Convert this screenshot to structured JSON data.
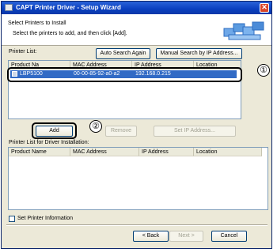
{
  "window": {
    "title": "CAPT Printer Driver - Setup Wizard",
    "close_glyph": "✕"
  },
  "header": {
    "heading": "Select Printers to Install",
    "subheading": "Select the printers to add, and then click [Add]."
  },
  "printer_list": {
    "label": "Printer List:",
    "auto_search_label": "Auto Search Again",
    "manual_search_label": "Manual Search by IP Address...",
    "columns": [
      "Product Na",
      "MAC Address",
      "IP Address",
      "Location"
    ],
    "rows": [
      {
        "product": "LBP5100",
        "mac": "00-00-85-92-a0-a2",
        "ip": "192.168.0.215"
      }
    ]
  },
  "actions": {
    "add_label": "Add",
    "remove_label": "Remove",
    "set_ip_label": "Set IP Address..."
  },
  "install_list": {
    "label": "Printer List for Driver Installation:",
    "columns": [
      "Product Name",
      "MAC Address",
      "IP Address",
      "Location"
    ]
  },
  "set_printer_info": {
    "label": "Set Printer Information",
    "checked": false
  },
  "footer": {
    "back_label": "< Back",
    "next_label": "Next >",
    "cancel_label": "Cancel"
  },
  "callouts": {
    "one": "①",
    "two": "②"
  },
  "colors": {
    "selection": "#316ac5",
    "title_bar": "#0a3fbf",
    "dialog_bg": "#ece9d8"
  }
}
